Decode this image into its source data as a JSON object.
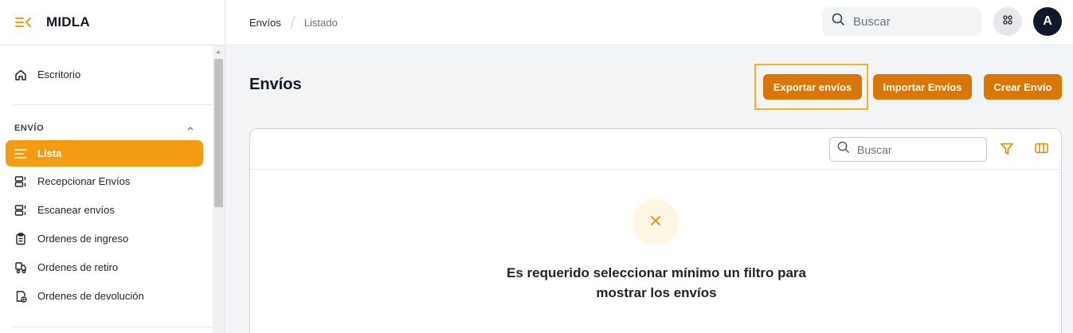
{
  "app": {
    "name": "MIDLA"
  },
  "sidebar": {
    "top_item": {
      "label": "Escritorio",
      "icon": "home-icon"
    },
    "section": {
      "label": "ENVÍO"
    },
    "items": [
      {
        "label": "Lista",
        "icon": "list-icon",
        "active": true
      },
      {
        "label": "Recepcionar Envíos",
        "icon": "receive-icon"
      },
      {
        "label": "Escanear envíos",
        "icon": "scan-icon"
      },
      {
        "label": "Ordenes de ingreso",
        "icon": "clipboard-icon"
      },
      {
        "label": "Ordenes de retiro",
        "icon": "truck-icon"
      },
      {
        "label": "Ordenes de devolución",
        "icon": "return-doc-icon"
      }
    ]
  },
  "header": {
    "breadcrumb": [
      "Envíos",
      "Listado"
    ],
    "search_placeholder": "Buscar",
    "avatar_initial": "A"
  },
  "main": {
    "title": "Envíos",
    "buttons": {
      "export": "Exportar envíos",
      "import": "Importar Envíos",
      "create": "Crear Envío"
    },
    "table": {
      "search_placeholder": "Buscar",
      "empty_message_line1": "Es requerido seleccionar mínimo un filtro para",
      "empty_message_line2": "mostrar los envíos"
    }
  },
  "colors": {
    "accent": "#f39c12",
    "button": "#d97706",
    "focus": "#f5b320",
    "avatar_bg": "#0f172a"
  }
}
